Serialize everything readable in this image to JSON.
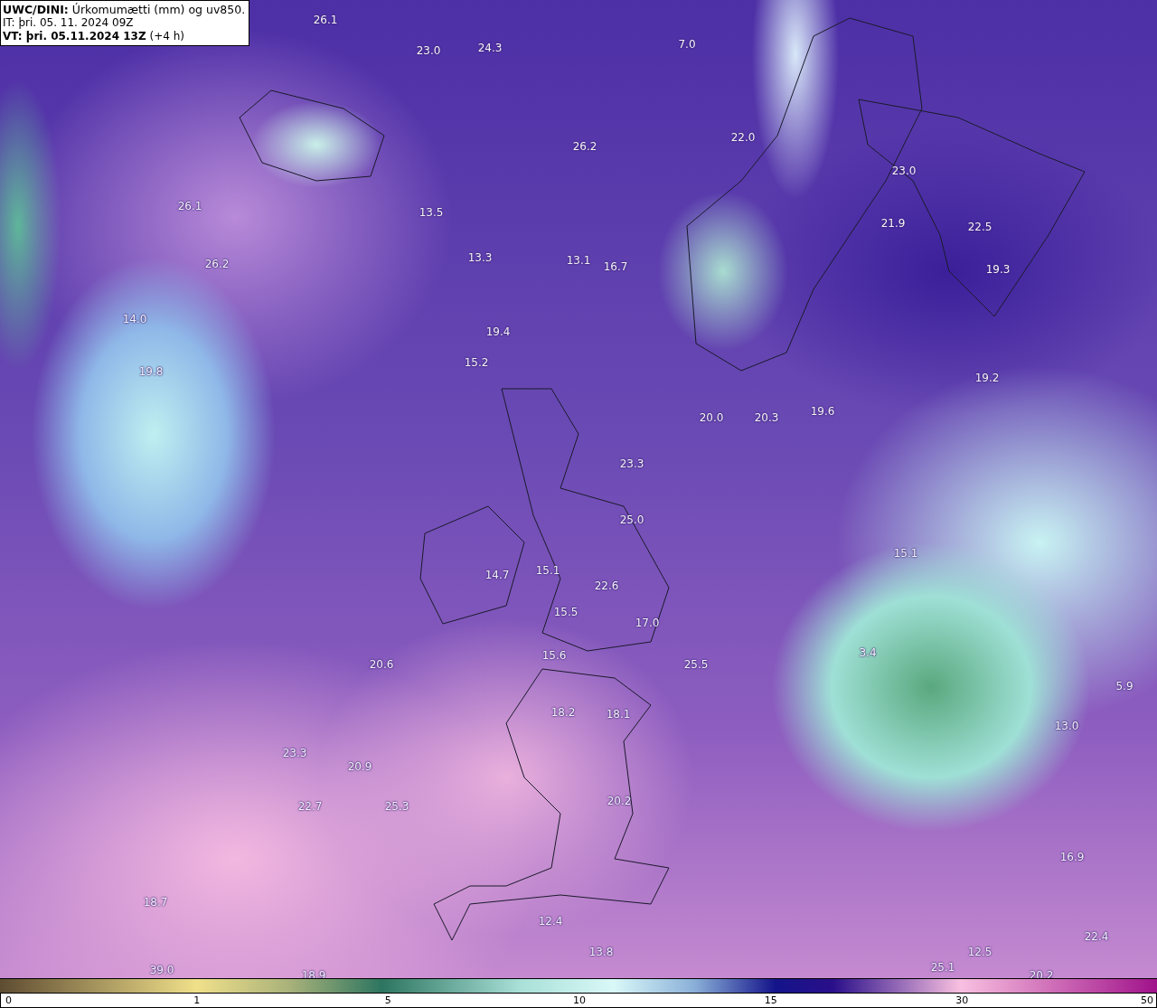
{
  "header": {
    "title": "**UWC/DINI:** Úrkomumætti (mm) og uv850.",
    "initial_time": "IT: þri. 05. 11. 2024 09Z",
    "valid_time": "**VT: þri. 05.11.2024 13Z** (+4 h)"
  },
  "map_labels": [
    "26.1",
    "23.0",
    "24.3",
    "7.0",
    "26.2",
    "22.0",
    "23.0",
    "26.1",
    "13.5",
    "21.9",
    "22.5",
    "26.2",
    "13.3",
    "13.1",
    "16.7",
    "19.3",
    "14.0",
    "19.4",
    "19.8",
    "15.2",
    "19.2",
    "20.0",
    "20.3",
    "19.6",
    "23.3",
    "25.0",
    "15.1",
    "14.7",
    "15.1",
    "22.6",
    "15.5",
    "17.0",
    "15.6",
    "20.6",
    "25.5",
    "3.4",
    "5.9",
    "18.2",
    "18.1",
    "13.0",
    "23.3",
    "20.9",
    "22.7",
    "25.3",
    "20.2",
    "16.9",
    "18.7",
    "12.4",
    "13.8",
    "22.4",
    "12.5",
    "39.0",
    "18.9",
    "25.1",
    "20.2"
  ],
  "legend": {
    "ticks": [
      "0",
      "1",
      "5",
      "10",
      "15",
      "30",
      "50"
    ]
  }
}
